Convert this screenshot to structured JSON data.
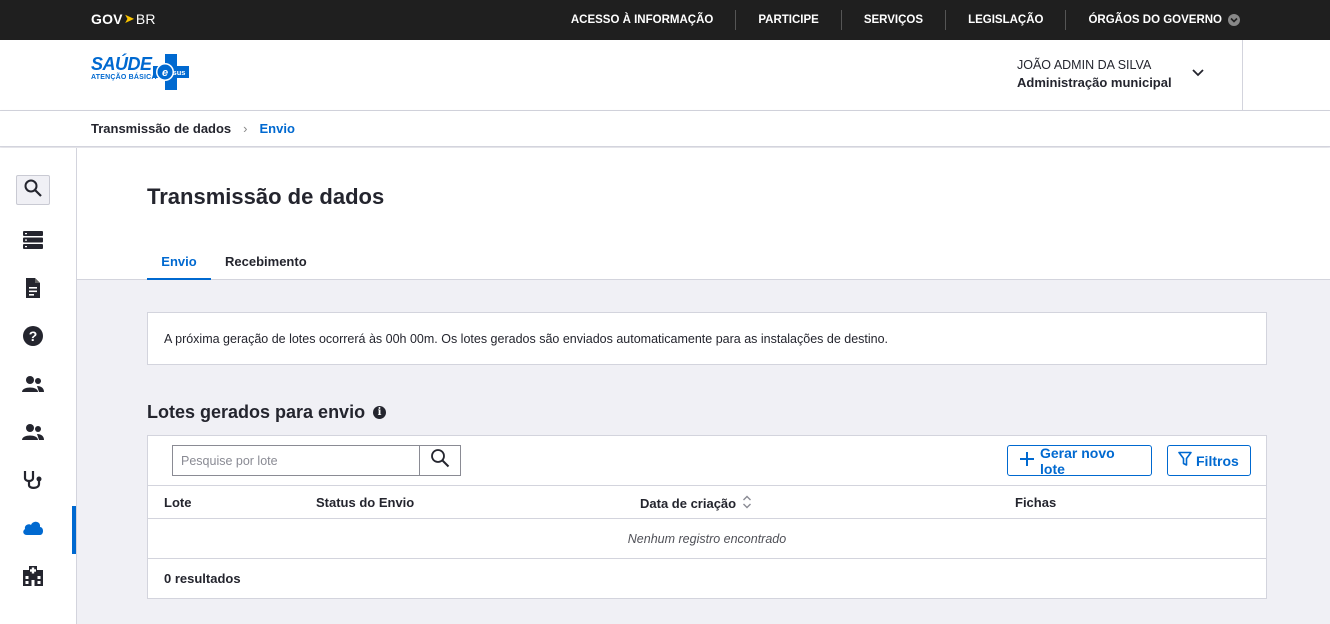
{
  "govbar": {
    "logo_gov": "GOV",
    "logo_br": "BR",
    "nav": [
      "ACESSO À INFORMAÇÃO",
      "PARTICIPE",
      "SERVIÇOS",
      "LEGISLAÇÃO",
      "ÓRGÃOS DO GOVERNO"
    ]
  },
  "header": {
    "brand_main": "SAÚDE",
    "brand_sub": "ATENÇÃO BÁSICA",
    "brand_badge": "e sus",
    "user_name": "JOÃO ADMIN DA SILVA",
    "user_role": "Administração municipal"
  },
  "breadcrumb": {
    "items": [
      "Transmissão de dados",
      "Envio"
    ],
    "separator": "›"
  },
  "sidebar": {
    "icons": [
      "search-icon",
      "list-icon",
      "document-icon",
      "help-icon",
      "people-icon",
      "people-icon",
      "stethoscope-icon",
      "cloud-icon",
      "hospital-icon"
    ],
    "active": "cloud-icon"
  },
  "page": {
    "title": "Transmissão de dados",
    "tabs": [
      "Envio",
      "Recebimento"
    ],
    "active_tab": "Envio",
    "info_text": "A próxima geração de lotes ocorrerá às 00h 00m. Os lotes gerados são enviados automaticamente para as instalações de destino."
  },
  "lotes": {
    "title": "Lotes gerados para envio",
    "search_placeholder": "Pesquise por lote",
    "gerar_label": "Gerar novo lote",
    "filtros_label": "Filtros",
    "columns": [
      "Lote",
      "Status do Envio",
      "Data de criação",
      "Fichas"
    ],
    "empty_text": "Nenhum registro encontrado",
    "results_text": "0 resultados"
  },
  "colors": {
    "primary": "#0069d0",
    "govbar": "#1f1f1f",
    "text": "#24252e",
    "background": "#f0f0f5"
  }
}
